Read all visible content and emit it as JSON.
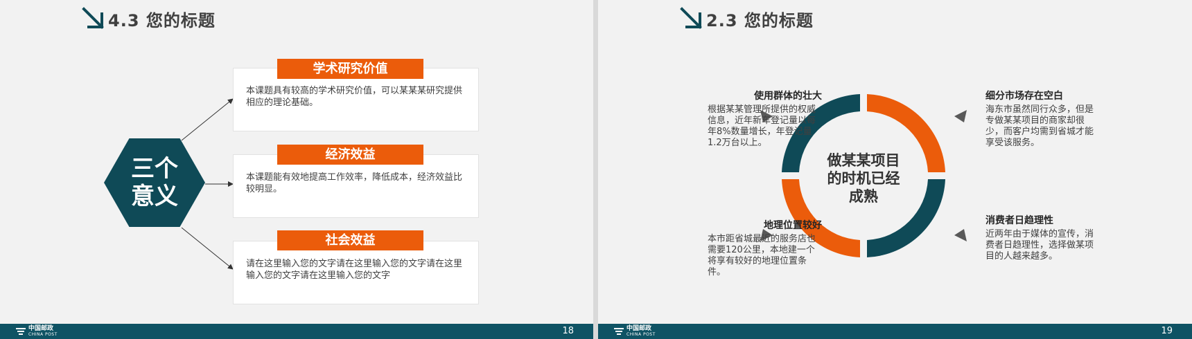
{
  "left_slide": {
    "title": "4.3 您的标题",
    "hexagon_text": "三个意义",
    "cards": [
      {
        "heading": "学术研究价值",
        "body": "本课题具有较高的学术研究价值，可以某某某研究提供相应的理论基础。"
      },
      {
        "heading": "经济效益",
        "body": "本课题能有效地提高工作效率，降低成本，经济效益比较明显。"
      },
      {
        "heading": "社会效益",
        "body": "请在这里输入您的文字请在这里输入您的文字请在这里输入您的文字请在这里输入您的文字"
      }
    ],
    "footer": {
      "logo_cn": "中国邮政",
      "logo_en": "CHINA POST",
      "page": "18"
    }
  },
  "right_slide": {
    "title": "2.3 您的标题",
    "center_text": "做某某项目的时机已经成熟",
    "quadrants": [
      {
        "title": "使用群体的壮大",
        "body": "根据某某管理所提供的权威信息，近年新车登记量以每年8%数量增长，年登记量1.2万台以上。"
      },
      {
        "title": "细分市场存在空白",
        "body": "海东市虽然同行众多，但是专做某某项目的商家却很少，而客户均需到省城才能享受该服务。"
      },
      {
        "title": "地理位置较好",
        "body": "本市距省城最近的服务店也需要120公里，本地建一个将享有较好的地理位置条件。"
      },
      {
        "title": "消费者日趋理性",
        "body": "近两年由于媒体的宣传，消费者日趋理性，选择做某项目的人越来越多。"
      }
    ],
    "footer": {
      "logo_cn": "中国邮政",
      "logo_en": "CHINA POST",
      "page": "19"
    }
  },
  "colors": {
    "accent_orange": "#eb5c0b",
    "accent_teal": "#0f4a57",
    "footer_bar": "#0f5364",
    "background": "#f2f2f2"
  },
  "icons": {
    "title_marker": "arrow-down-right-icon",
    "footer_logo": "china-post-logo-icon",
    "quadrant_marker": "triangle-pointer-icon"
  }
}
